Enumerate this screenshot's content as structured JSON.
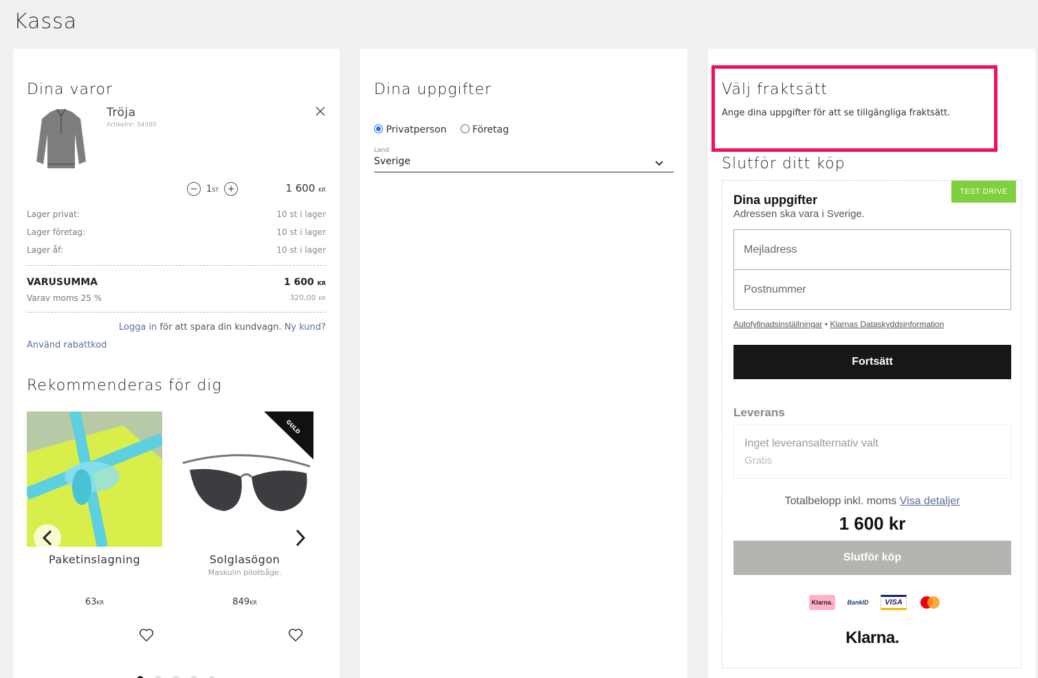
{
  "page": {
    "title": "Kassa"
  },
  "cart": {
    "heading": "Dina varor",
    "item": {
      "name": "Tröja",
      "article": "Artikelnr: 54380",
      "qty": "1",
      "qty_unit": "ST",
      "price": "1 600",
      "currency": "KR"
    },
    "stock": [
      {
        "label": "Lager privat:",
        "value": "10 st i lager"
      },
      {
        "label": "Lager företag:",
        "value": "10 st i lager"
      },
      {
        "label": "Lager åf:",
        "value": "10 st i lager"
      }
    ],
    "sum_label": "VARUSUMMA",
    "sum_value": "1 600",
    "sum_currency": "KR",
    "vat_label": "Varav moms 25 %",
    "vat_value": "320,00",
    "vat_currency": "KR",
    "login_link": "Logga in",
    "login_text": " för att spara din kundvagn.",
    "new_customer": "Ny kund?",
    "discount": "Använd rabattkod"
  },
  "recommend": {
    "heading": "Rekommenderas för dig",
    "badge": "GULD",
    "products": [
      {
        "name": "Paketinslagning",
        "desc": "",
        "price": "63",
        "currency": "KR"
      },
      {
        "name": "Solglasögon",
        "desc": "Maskulin pilotbåge.",
        "price": "849",
        "currency": "KR"
      }
    ],
    "dots": 5,
    "active_dot": 0
  },
  "details": {
    "heading": "Dina uppgifter",
    "customer_types": [
      {
        "label": "Privatperson",
        "checked": true
      },
      {
        "label": "Företag",
        "checked": false
      }
    ],
    "country_label": "Land",
    "country_value": "Sverige"
  },
  "shipping": {
    "heading": "Välj fraktsätt",
    "info": "Ange dina uppgifter för att se tillgängliga fraktsätt."
  },
  "checkout": {
    "heading": "Slutför ditt köp",
    "test_badge": "TEST DRIVE",
    "title": "Dina uppgifter",
    "subtitle": "Adressen ska vara i Sverige.",
    "email_placeholder": "Mejladress",
    "postal_placeholder": "Postnummer",
    "autofill_link": "Autofyllnadsinställningar",
    "separator": "•",
    "privacy_link": "Klarnas Dataskyddsinformation",
    "continue_button": "Fortsätt",
    "delivery_heading": "Leverans",
    "delivery_option": "Inget leveransalternativ valt",
    "delivery_price": "Gratis",
    "total_label": "Totalbelopp inkl. moms",
    "details_link": "Visa detaljer",
    "total_value": "1 600 kr",
    "finish_button": "Slutför köp",
    "payment_icons": [
      "Klarna.",
      "BankID",
      "VISA",
      "mastercard"
    ],
    "brand": "Klarna."
  },
  "colors": {
    "highlight": "#f50d62",
    "test_badge": "#7ed13c",
    "link": "#5a6f9a",
    "button_dark": "#171717",
    "button_disabled": "#b5b4b0"
  }
}
